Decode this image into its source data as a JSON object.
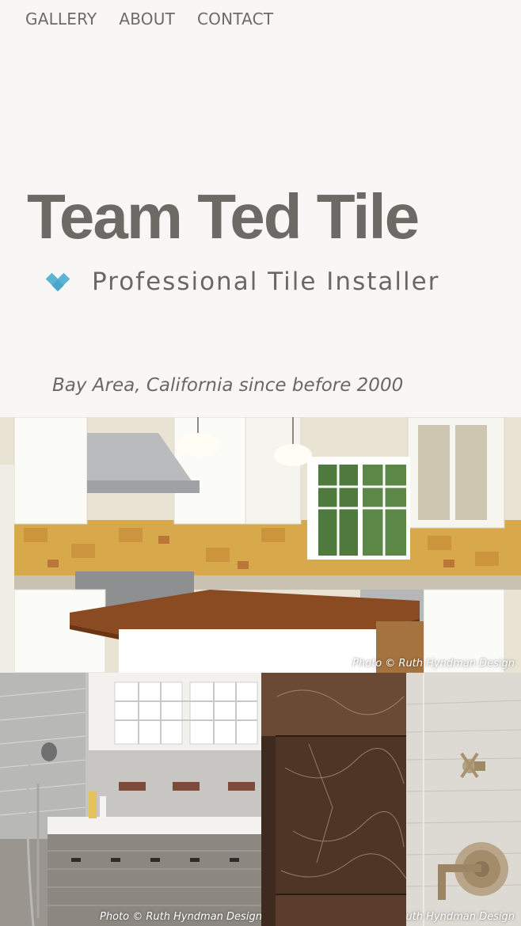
{
  "nav": {
    "items": [
      {
        "label": "GALLERY"
      },
      {
        "label": "ABOUT"
      },
      {
        "label": "CONTACT"
      }
    ]
  },
  "hero": {
    "title": "Team Ted Tile",
    "tagline": "Professional Tile Installer",
    "since": "Bay Area, California since before 2000",
    "logo_icon": "diamond-tiles-icon",
    "accent_color": "#5bb3d6"
  },
  "gallery": {
    "kitchen_credit": "Photo © Ruth Hyndman Design",
    "bath_credit": "Photo © Ruth Hyndman Design",
    "shower_credit": "Photo © Ruth Hyndman Design"
  }
}
